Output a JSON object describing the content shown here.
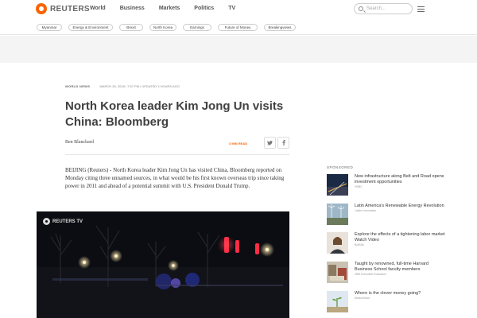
{
  "header": {
    "brand": "REUTERS",
    "nav": [
      "World",
      "Business",
      "Markets",
      "Politics",
      "TV"
    ],
    "search_placeholder": "Search..."
  },
  "tags": [
    "Myanmar",
    "Energy & Environment",
    "Brexit",
    "North Korea",
    "Earnings",
    "Future of Money",
    "Breakingviews"
  ],
  "article": {
    "section": "WORLD NEWS",
    "date": "MARCH 26, 2018 / 7:57 PM / UPDATED 3 HOURS AGO",
    "headline": "North Korea leader Kim Jong Un visits China: Bloomberg",
    "byline": "Ben Blanchard",
    "read_time": "3 MIN READ",
    "body": "BEIJING (Reuters) - North Korea leader Kim Jong Un has visited China, Bloomberg reported on Monday citing three unnamed sources, in what would be his first known overseas trip since taking power in 2011 and ahead of a potential summit with U.S. President Donald Trump.",
    "video_label": "REUTERS TV"
  },
  "sidebar": {
    "heading": "SPONSORED",
    "items": [
      {
        "title": "New infrastructure along Belt and Road opens investment opportunities",
        "source": "HSBC"
      },
      {
        "title": "Latin America's Renewable Energy Revolution",
        "source": "LatAm Innovation"
      },
      {
        "title": "Explore the effects of a tightening labor market Watch Video",
        "source": "BofAML"
      },
      {
        "title": "Taught by renowned, full-time Harvard Business School faculty members",
        "source": "HBS Executive Education"
      },
      {
        "title": "Where is the clever money going?",
        "source": "MarketVoice"
      }
    ]
  },
  "colors": {
    "accent": "#fa6400",
    "text": "#404040"
  }
}
